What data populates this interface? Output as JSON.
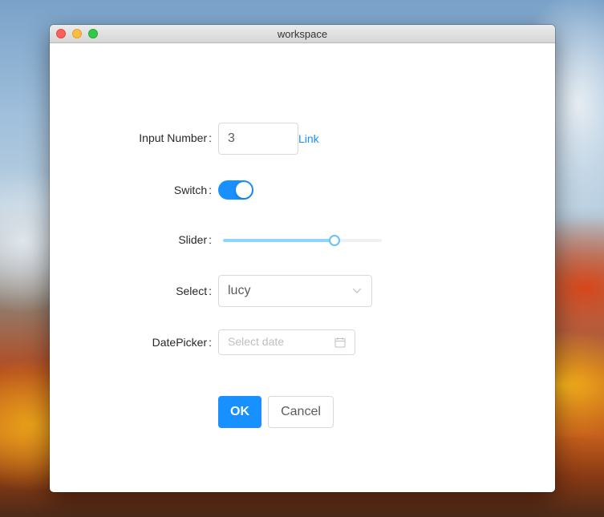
{
  "window": {
    "title": "workspace"
  },
  "form": {
    "input_number": {
      "label": "Input Number",
      "value": "3",
      "link_text": "Link"
    },
    "switch": {
      "label": "Switch",
      "checked": true
    },
    "slider": {
      "label": "Slider",
      "value_fraction": 0.7
    },
    "select": {
      "label": "Select",
      "value": "lucy"
    },
    "datepicker": {
      "label": "DatePicker",
      "placeholder": "Select date"
    }
  },
  "buttons": {
    "ok_label": "OK",
    "cancel_label": "Cancel"
  },
  "colors": {
    "primary": "#1890ff",
    "slider_track": "#91d5ff",
    "slider_handle": "#69c0ff"
  },
  "icons": {
    "select_arrow": "chevron-down-icon",
    "datepicker": "calendar-icon"
  }
}
